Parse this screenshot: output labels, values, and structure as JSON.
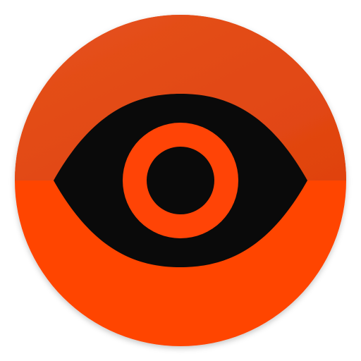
{
  "icon": {
    "name": "eye-icon",
    "colors": {
      "top_half": "#E0420E",
      "top_half_highlight": "#E5531E",
      "bottom_half": "#FF4406",
      "eye_shape": "#0A0A0A",
      "iris_ring": "#FF4406",
      "pupil": "#0A0A0A",
      "background": "#FFFFFF"
    }
  }
}
